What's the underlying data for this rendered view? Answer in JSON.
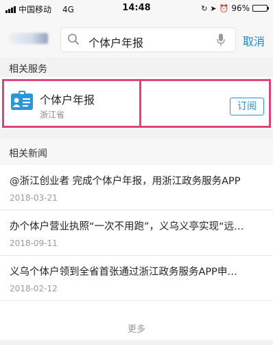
{
  "status_bar": {
    "carrier": "中国移动",
    "network": "4G",
    "time": "14:48",
    "battery": "96%",
    "battery_level": 0.96,
    "icons": [
      "signal-icon",
      "rotation-lock-icon",
      "location-icon",
      "alarm-icon",
      "battery-icon"
    ]
  },
  "search": {
    "query": "个体户年报",
    "cancel_label": "取消"
  },
  "services": {
    "section_title": "相关服务",
    "items": [
      {
        "name": "个体户年报",
        "region": "浙江省",
        "action_label": "订阅",
        "icon": "id-card-icon"
      }
    ]
  },
  "news": {
    "section_title": "相关新闻",
    "items": [
      {
        "title": "@浙江创业者 完成个体户年报，用浙江政务服务APP",
        "date": "2018-03-21"
      },
      {
        "title": "办个体户营业执照“一次不用跑”，义乌义亭实现“远…",
        "date": "2018-09-11"
      },
      {
        "title": "义乌个体户领到全省首张通过浙江政务服务APP申…",
        "date": "2018-02-12"
      }
    ],
    "more_label": "更多"
  },
  "colors": {
    "accent": "#1e88d0",
    "highlight": "#e0437a",
    "background_gray": "#f2f2f2"
  }
}
